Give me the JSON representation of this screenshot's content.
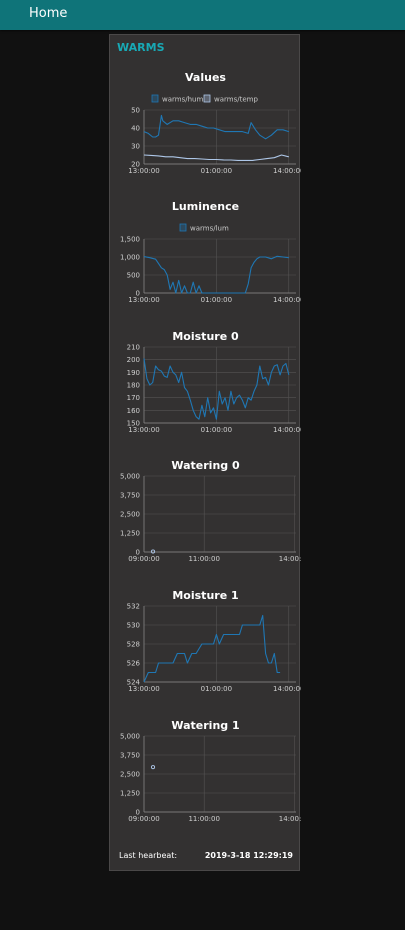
{
  "nav": {
    "home_label": "Home"
  },
  "panel": {
    "title": "WARMS"
  },
  "colors": {
    "accent": "#18a9b5",
    "header_bg": "#0f7479",
    "series_blue": "#1f77b4",
    "series_light": "#aec7e8"
  },
  "chart_data": [
    {
      "id": "values",
      "type": "line",
      "title": "Values",
      "ylim": [
        20,
        50
      ],
      "yticks": [
        50,
        40,
        30,
        20
      ],
      "ytick_labels": [
        "50",
        "40",
        "30",
        "20"
      ],
      "xlim_hours": [
        13.0,
        14.05
      ],
      "xticks_hours": [
        13.0,
        13.5,
        14.0
      ],
      "xtick_labels": [
        "13:00:00",
        "01:00:00",
        "14:00:00"
      ],
      "legend": [
        "warms/hum",
        "warms/temp"
      ],
      "series": [
        {
          "name": "warms/hum",
          "color": "#1f77b4",
          "x": [
            13.0,
            13.03,
            13.06,
            13.08,
            13.1,
            13.12,
            13.13,
            13.16,
            13.2,
            13.24,
            13.28,
            13.32,
            13.36,
            13.4,
            13.44,
            13.48,
            13.52,
            13.56,
            13.6,
            13.64,
            13.68,
            13.72,
            13.74,
            13.77,
            13.8,
            13.84,
            13.88,
            13.92,
            13.96,
            14.0
          ],
          "values": [
            38,
            37,
            35,
            35,
            36,
            47,
            44,
            42,
            44,
            44,
            43,
            42,
            42,
            41,
            40,
            40,
            39,
            38,
            38,
            38,
            38,
            37,
            43,
            39,
            36,
            34,
            36,
            39,
            39,
            38
          ]
        },
        {
          "name": "warms/temp",
          "color": "#aec7e8",
          "x": [
            13.0,
            13.05,
            13.1,
            13.15,
            13.2,
            13.25,
            13.3,
            13.35,
            13.4,
            13.45,
            13.5,
            13.55,
            13.6,
            13.65,
            13.7,
            13.75,
            13.8,
            13.85,
            13.9,
            13.95,
            14.0
          ],
          "values": [
            25,
            24.8,
            24.5,
            24,
            24,
            23.5,
            23,
            23,
            22.8,
            22.5,
            22.5,
            22.3,
            22.2,
            22,
            22,
            22,
            22.5,
            23,
            23.5,
            25,
            24
          ]
        }
      ]
    },
    {
      "id": "luminence",
      "type": "line",
      "title": "Luminence",
      "ylim": [
        0,
        1500
      ],
      "yticks": [
        1500,
        1000,
        500,
        0
      ],
      "ytick_labels": [
        "1,500",
        "1,000",
        "500",
        "0"
      ],
      "xlim_hours": [
        13.0,
        14.05
      ],
      "xticks_hours": [
        13.0,
        13.5,
        14.0
      ],
      "xtick_labels": [
        "13:00:00",
        "01:00:00",
        "14:00:00"
      ],
      "legend": [
        "warms/lum"
      ],
      "series": [
        {
          "name": "warms/lum",
          "color": "#1f77b4",
          "x": [
            13.0,
            13.04,
            13.08,
            13.12,
            13.14,
            13.16,
            13.18,
            13.2,
            13.22,
            13.24,
            13.26,
            13.28,
            13.3,
            13.32,
            13.34,
            13.36,
            13.38,
            13.4,
            13.5,
            13.6,
            13.7,
            13.72,
            13.74,
            13.76,
            13.78,
            13.8,
            13.84,
            13.88,
            13.92,
            13.96,
            14.0
          ],
          "values": [
            1010,
            980,
            940,
            700,
            650,
            500,
            100,
            300,
            0,
            350,
            0,
            200,
            0,
            0,
            300,
            0,
            200,
            0,
            0,
            0,
            0,
            250,
            700,
            850,
            950,
            1000,
            1000,
            950,
            1020,
            1000,
            980
          ]
        }
      ]
    },
    {
      "id": "moisture0",
      "type": "line",
      "title": "Moisture 0",
      "ylim": [
        150,
        210
      ],
      "yticks": [
        210,
        200,
        190,
        180,
        170,
        160,
        150
      ],
      "ytick_labels": [
        "210",
        "200",
        "190",
        "180",
        "170",
        "160",
        "150"
      ],
      "xlim_hours": [
        13.0,
        14.05
      ],
      "xticks_hours": [
        13.0,
        13.5,
        14.0
      ],
      "xtick_labels": [
        "13:00:00",
        "01:00:00",
        "14:00:00"
      ],
      "legend": [],
      "series": [
        {
          "name": "",
          "color": "#1f77b4",
          "x": [
            13.0,
            13.02,
            13.04,
            13.06,
            13.08,
            13.1,
            13.12,
            13.14,
            13.16,
            13.18,
            13.2,
            13.22,
            13.24,
            13.26,
            13.28,
            13.3,
            13.32,
            13.34,
            13.36,
            13.38,
            13.4,
            13.42,
            13.44,
            13.46,
            13.48,
            13.5,
            13.52,
            13.54,
            13.56,
            13.58,
            13.6,
            13.62,
            13.64,
            13.66,
            13.68,
            13.7,
            13.72,
            13.74,
            13.76,
            13.78,
            13.8,
            13.82,
            13.84,
            13.86,
            13.88,
            13.9,
            13.92,
            13.94,
            13.96,
            13.98,
            14.0
          ],
          "values": [
            201,
            185,
            180,
            182,
            195,
            192,
            191,
            187,
            186,
            195,
            190,
            188,
            182,
            190,
            178,
            175,
            168,
            160,
            155,
            153,
            164,
            155,
            170,
            158,
            162,
            153,
            175,
            165,
            170,
            160,
            175,
            165,
            170,
            172,
            168,
            162,
            170,
            168,
            175,
            180,
            195,
            185,
            186,
            180,
            190,
            195,
            196,
            188,
            195,
            197,
            188
          ]
        }
      ]
    },
    {
      "id": "watering0",
      "type": "scatter",
      "title": "Watering 0",
      "ylim": [
        0,
        5000
      ],
      "yticks": [
        5000,
        3750,
        2500,
        1250,
        0
      ],
      "ytick_labels": [
        "5,000",
        "3,750",
        "2,500",
        "1,250",
        "0"
      ],
      "xlim_hours": [
        9.0,
        14.05
      ],
      "xticks_hours": [
        9.0,
        11.0,
        14.0
      ],
      "xtick_labels": [
        "09:00:00",
        "11:00:00",
        "14:00:00"
      ],
      "legend": [],
      "series": [
        {
          "name": "",
          "color": "#aec7e8",
          "x": [
            9.3
          ],
          "values": [
            30
          ]
        }
      ]
    },
    {
      "id": "moisture1",
      "type": "line",
      "title": "Moisture 1",
      "ylim": [
        524,
        532
      ],
      "yticks": [
        532,
        530,
        528,
        526,
        524
      ],
      "ytick_labels": [
        "532",
        "530",
        "528",
        "526",
        "524"
      ],
      "xlim_hours": [
        13.0,
        14.05
      ],
      "xticks_hours": [
        13.0,
        13.5,
        14.0
      ],
      "xtick_labels": [
        "13:00:00",
        "01:00:00",
        "14:00:00"
      ],
      "legend": [],
      "series": [
        {
          "name": "",
          "color": "#1f77b4",
          "x": [
            13.0,
            13.03,
            13.06,
            13.08,
            13.1,
            13.13,
            13.16,
            13.2,
            13.23,
            13.26,
            13.28,
            13.3,
            13.33,
            13.36,
            13.4,
            13.43,
            13.46,
            13.48,
            13.5,
            13.52,
            13.55,
            13.58,
            13.6,
            13.62,
            13.64,
            13.66,
            13.68,
            13.7,
            13.72,
            13.74,
            13.76,
            13.78,
            13.8,
            13.82,
            13.84,
            13.86,
            13.88,
            13.9,
            13.92,
            13.94
          ],
          "values": [
            524,
            525,
            525,
            525,
            526,
            526,
            526,
            526,
            527,
            527,
            527,
            526,
            527,
            527,
            528,
            528,
            528,
            528,
            529,
            528,
            529,
            529,
            529,
            529,
            529,
            529,
            530,
            530,
            530,
            530,
            530,
            530,
            530,
            531,
            527,
            526,
            526,
            527,
            525,
            525
          ]
        }
      ]
    },
    {
      "id": "watering1",
      "type": "scatter",
      "title": "Watering 1",
      "ylim": [
        0,
        5000
      ],
      "yticks": [
        5000,
        3750,
        2500,
        1250,
        0
      ],
      "ytick_labels": [
        "5,000",
        "3,750",
        "2,500",
        "1,250",
        "0"
      ],
      "xlim_hours": [
        9.0,
        14.05
      ],
      "xticks_hours": [
        9.0,
        11.0,
        14.0
      ],
      "xtick_labels": [
        "09:00:00",
        "11:00:00",
        "14:00:00"
      ],
      "legend": [],
      "series": [
        {
          "name": "",
          "color": "#aec7e8",
          "x": [
            9.3
          ],
          "values": [
            2950
          ]
        }
      ]
    }
  ],
  "footer": {
    "label": "Last hearbeat:",
    "value": "2019-3-18 12:29:19"
  }
}
